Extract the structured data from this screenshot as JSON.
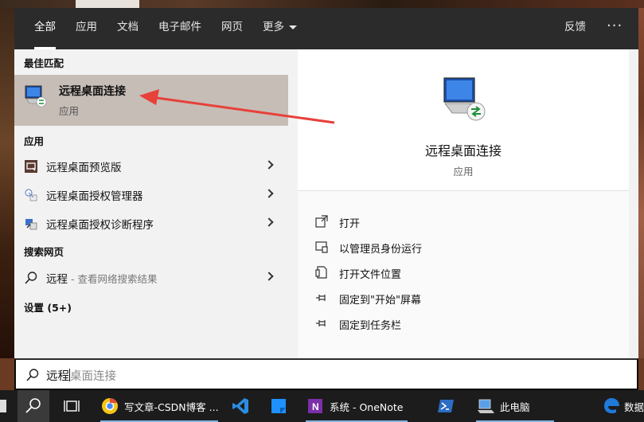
{
  "tabs": [
    {
      "label": "全部",
      "active": true
    },
    {
      "label": "应用"
    },
    {
      "label": "文档"
    },
    {
      "label": "电子邮件"
    },
    {
      "label": "网页"
    },
    {
      "label": "更多"
    }
  ],
  "header": {
    "feedback": "反馈",
    "more_dots": "···"
  },
  "sections": {
    "best_match": "最佳匹配",
    "apps": "应用",
    "web": "搜索网页",
    "settings": "设置 (5+)"
  },
  "best_match": {
    "name": "远程桌面连接",
    "type": "应用",
    "icon": "remote-desktop-icon"
  },
  "apps": [
    {
      "label": "远程桌面预览版",
      "icon": "remote-desktop-preview-icon"
    },
    {
      "label": "远程桌面授权管理器",
      "icon": "license-manager-icon"
    },
    {
      "label": "远程桌面授权诊断程序",
      "icon": "license-diagnoser-icon"
    }
  ],
  "web_result": {
    "query": "远程",
    "hint": " - 查看网络搜索结果",
    "icon": "search-icon"
  },
  "detail": {
    "title": "远程桌面连接",
    "subtitle": "应用",
    "actions": [
      {
        "label": "打开",
        "icon": "open-icon"
      },
      {
        "label": "以管理员身份运行",
        "icon": "shield-icon"
      },
      {
        "label": "打开文件位置",
        "icon": "file-location-icon"
      },
      {
        "label": "固定到\"开始\"屏幕",
        "icon": "pin-icon"
      },
      {
        "label": "固定到任务栏",
        "icon": "pin-icon"
      }
    ]
  },
  "search": {
    "typed": "远程",
    "suggestion": "桌面连接"
  },
  "taskbar": {
    "items": [
      {
        "label": "",
        "icon": "search-icon"
      },
      {
        "label": "",
        "icon": "task-view-icon"
      },
      {
        "label": "写文章-CSDN博客 ...",
        "icon": "chrome-icon"
      },
      {
        "label": "",
        "icon": "vscode-icon"
      },
      {
        "label": "",
        "icon": "sticky-notes-icon"
      },
      {
        "label": "系统 - OneNote",
        "icon": "onenote-icon"
      },
      {
        "label": "",
        "icon": "powershell-icon"
      },
      {
        "label": "此电脑",
        "icon": "this-pc-icon"
      },
      {
        "label": "数据",
        "icon": "edge-icon"
      }
    ]
  },
  "colors": {
    "accent": "#2b2b2b",
    "selection": "#c6bdb7",
    "arrow": "#e8403a"
  }
}
